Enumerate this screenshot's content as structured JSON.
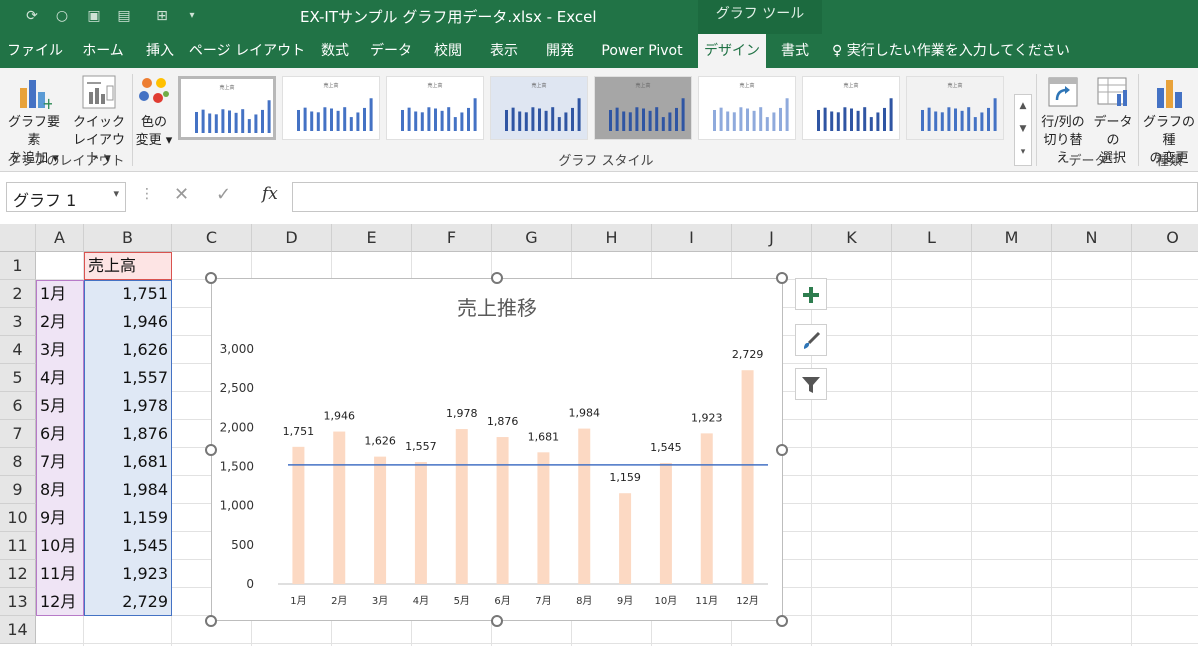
{
  "titlebar": {
    "title": "EX-ITサンプル  グラフ用データ.xlsx  -  Excel",
    "contextual": "グラフ ツール",
    "qat_icons": [
      "autosave-icon",
      "circle-icon",
      "save-icon",
      "print-preview-icon",
      "table-icon",
      "sort-icon",
      "dropdown-icon"
    ]
  },
  "tabs": [
    "ファイル",
    "ホーム",
    "挿入",
    "ページ レイアウト",
    "数式",
    "データ",
    "校閲",
    "表示",
    "開発",
    "Power Pivot",
    "デザイン",
    "書式"
  ],
  "tellme": "実行したい作業を入力してください",
  "ribbon": {
    "add_element": [
      "グラフ要素",
      "を追加 ▾"
    ],
    "quick_layout": [
      "クイック",
      "レイアウト ▾"
    ],
    "change_color": [
      "色の",
      "変更 ▾"
    ],
    "layout_group": "グラフのレイアウト",
    "styles_group": "グラフ スタイル",
    "switch_rowcol": [
      "行/列の",
      "切り替え"
    ],
    "select_data": [
      "データの",
      "選択"
    ],
    "data_group": "データ",
    "change_type": [
      "グラフの種",
      "の変更"
    ],
    "type_group": "種類",
    "thumb_title": "売上高"
  },
  "formula_bar": {
    "name_box": "グラフ 1",
    "fx": "fx",
    "formula": ""
  },
  "columns": [
    "A",
    "B",
    "C",
    "D",
    "E",
    "F",
    "G",
    "H",
    "I",
    "J",
    "K",
    "L",
    "M",
    "N",
    "O"
  ],
  "rows": [
    "1",
    "2",
    "3",
    "4",
    "5",
    "6",
    "7",
    "8",
    "9",
    "10",
    "11",
    "12",
    "13",
    "14"
  ],
  "cells": {
    "B1": "売上高",
    "A": [
      "1月",
      "2月",
      "3月",
      "4月",
      "5月",
      "6月",
      "7月",
      "8月",
      "9月",
      "10月",
      "11月",
      "12月"
    ],
    "B": [
      "1,751",
      "1,946",
      "1,626",
      "1,557",
      "1,978",
      "1,876",
      "1,681",
      "1,984",
      "1,159",
      "1,545",
      "1,923",
      "2,729"
    ]
  },
  "chart_data": {
    "type": "bar",
    "title": "売上推移",
    "categories": [
      "1月",
      "2月",
      "3月",
      "4月",
      "5月",
      "6月",
      "7月",
      "8月",
      "9月",
      "10月",
      "11月",
      "12月"
    ],
    "values": [
      1751,
      1946,
      1626,
      1557,
      1978,
      1876,
      1681,
      1984,
      1159,
      1545,
      1923,
      2729
    ],
    "data_labels": [
      "1,751",
      "1,946",
      "1,626",
      "1,557",
      "1,978",
      "1,876",
      "1,681",
      "1,984",
      "1,159",
      "1,545",
      "1,923",
      "2,729"
    ],
    "y_ticks": [
      "0",
      "500",
      "1,000",
      "1,500",
      "2,000",
      "2,500",
      "3,000"
    ],
    "ylim": [
      0,
      3000
    ],
    "reference_line": 1520,
    "bar_color": "#fcd9c3",
    "line_color": "#4472c4",
    "grid": false
  },
  "chart_side_buttons": [
    "chart-elements-plus-icon",
    "chart-styles-brush-icon",
    "chart-filter-icon"
  ],
  "colors": {
    "excel_green": "#217346",
    "selected_fill": "#dfe8f5",
    "header_highlight": "#fde4e4"
  }
}
